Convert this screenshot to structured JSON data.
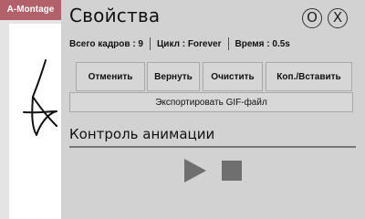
{
  "app": {
    "tab_label": "A-Montage"
  },
  "panel": {
    "title": "Свойства",
    "round_button_o": "O",
    "round_button_x": "X"
  },
  "info": {
    "frames": "Всего кадров : 9",
    "loop": "Цикл : Forever",
    "time": "Время : 0.5s"
  },
  "actions": {
    "undo": "Отменить",
    "redo": "Вернуть",
    "clear": "Очистить",
    "copy_paste": "Коп./Вставить",
    "export": "Экспортировать GIF-файл"
  },
  "animation": {
    "section_title": "Контроль анимации",
    "play_icon": "play-icon",
    "stop_icon": "stop-icon"
  },
  "colors": {
    "tab_background": "#b2606a",
    "panel_background": "#d2d2d2",
    "control_gray": "#6f6f6f"
  }
}
